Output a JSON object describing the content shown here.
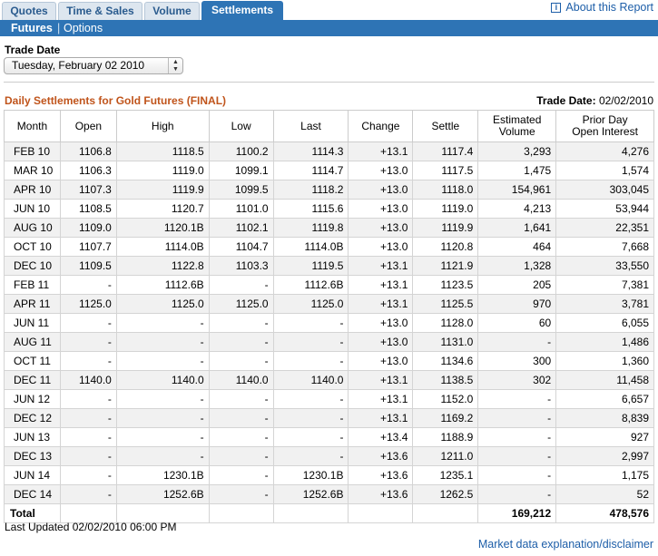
{
  "tabs": [
    "Quotes",
    "Time & Sales",
    "Volume",
    "Settlements"
  ],
  "about_link": "About this Report",
  "subnav": {
    "futures": "Futures",
    "separator": "|",
    "options": "Options"
  },
  "trade_date_label": "Trade Date",
  "trade_date_select": "Tuesday, February 02 2010",
  "report_heading": "Daily Settlements for Gold Futures (FINAL)",
  "trade_date_right_label": "Trade Date:",
  "trade_date_right_value": "02/02/2010",
  "table": {
    "headers": [
      "Month",
      "Open",
      "High",
      "Low",
      "Last",
      "Change",
      "Settle",
      "Estimated\nVolume",
      "Prior Day\nOpen Interest"
    ],
    "rows": [
      [
        "FEB 10",
        "1106.8",
        "1118.5",
        "1100.2",
        "1114.3",
        "+13.1",
        "1117.4",
        "3,293",
        "4,276"
      ],
      [
        "MAR 10",
        "1106.3",
        "1119.0",
        "1099.1",
        "1114.7",
        "+13.0",
        "1117.5",
        "1,475",
        "1,574"
      ],
      [
        "APR 10",
        "1107.3",
        "1119.9",
        "1099.5",
        "1118.2",
        "+13.0",
        "1118.0",
        "154,961",
        "303,045"
      ],
      [
        "JUN 10",
        "1108.5",
        "1120.7",
        "1101.0",
        "1115.6",
        "+13.0",
        "1119.0",
        "4,213",
        "53,944"
      ],
      [
        "AUG 10",
        "1109.0",
        "1120.1B",
        "1102.1",
        "1119.8",
        "+13.0",
        "1119.9",
        "1,641",
        "22,351"
      ],
      [
        "OCT 10",
        "1107.7",
        "1114.0B",
        "1104.7",
        "1114.0B",
        "+13.0",
        "1120.8",
        "464",
        "7,668"
      ],
      [
        "DEC 10",
        "1109.5",
        "1122.8",
        "1103.3",
        "1119.5",
        "+13.1",
        "1121.9",
        "1,328",
        "33,550"
      ],
      [
        "FEB 11",
        "-",
        "1112.6B",
        "-",
        "1112.6B",
        "+13.1",
        "1123.5",
        "205",
        "7,381"
      ],
      [
        "APR 11",
        "1125.0",
        "1125.0",
        "1125.0",
        "1125.0",
        "+13.1",
        "1125.5",
        "970",
        "3,781"
      ],
      [
        "JUN 11",
        "-",
        "-",
        "-",
        "-",
        "+13.0",
        "1128.0",
        "60",
        "6,055"
      ],
      [
        "AUG 11",
        "-",
        "-",
        "-",
        "-",
        "+13.0",
        "1131.0",
        "-",
        "1,486"
      ],
      [
        "OCT 11",
        "-",
        "-",
        "-",
        "-",
        "+13.0",
        "1134.6",
        "300",
        "1,360"
      ],
      [
        "DEC 11",
        "1140.0",
        "1140.0",
        "1140.0",
        "1140.0",
        "+13.1",
        "1138.5",
        "302",
        "11,458"
      ],
      [
        "JUN 12",
        "-",
        "-",
        "-",
        "-",
        "+13.1",
        "1152.0",
        "-",
        "6,657"
      ],
      [
        "DEC 12",
        "-",
        "-",
        "-",
        "-",
        "+13.1",
        "1169.2",
        "-",
        "8,839"
      ],
      [
        "JUN 13",
        "-",
        "-",
        "-",
        "-",
        "+13.4",
        "1188.9",
        "-",
        "927"
      ],
      [
        "DEC 13",
        "-",
        "-",
        "-",
        "-",
        "+13.6",
        "1211.0",
        "-",
        "2,997"
      ],
      [
        "JUN 14",
        "-",
        "1230.1B",
        "-",
        "1230.1B",
        "+13.6",
        "1235.1",
        "-",
        "1,175"
      ],
      [
        "DEC 14",
        "-",
        "1252.6B",
        "-",
        "1252.6B",
        "+13.6",
        "1262.5",
        "-",
        "52"
      ]
    ],
    "total": {
      "label": "Total",
      "volume": "169,212",
      "open_interest": "478,576"
    }
  },
  "last_updated": "Last Updated 02/02/2010 06:00 PM",
  "disclaimer_link": "Market data explanation/disclaimer",
  "colors": {
    "accent": "#2e74b5",
    "heading": "#c0541b",
    "link": "#1d5ea8"
  },
  "icons": {
    "about": "info-icon",
    "select": "chevron-updown-icon"
  }
}
